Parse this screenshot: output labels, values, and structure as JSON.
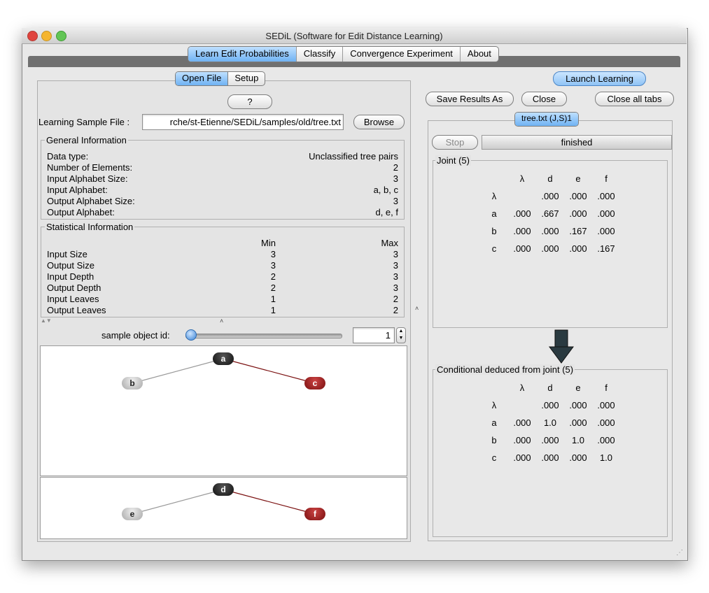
{
  "window": {
    "title": "SEDiL (Software for Edit Distance Learning)"
  },
  "main_tabs": [
    "Learn Edit Probabilities",
    "Classify",
    "Convergence Experiment",
    "About"
  ],
  "left": {
    "subtabs": [
      "Open File",
      "Setup"
    ],
    "help_label": "?",
    "file_label": "Learning Sample File :",
    "file_value": "rche/st-Etienne/SEDiL/samples/old/tree.txt",
    "browse_label": "Browse",
    "general": {
      "title": "General Information",
      "rows": [
        {
          "label": "Data type:",
          "value": "Unclassified tree pairs"
        },
        {
          "label": "Number of Elements:",
          "value": "2"
        },
        {
          "label": "Input Alphabet Size:",
          "value": "3"
        },
        {
          "label": "Input Alphabet:",
          "value": "a, b, c"
        },
        {
          "label": "Output Alphabet Size:",
          "value": "3"
        },
        {
          "label": "Output Alphabet:",
          "value": "d, e, f"
        }
      ]
    },
    "statistical": {
      "title": "Statistical Information",
      "col_min": "Min",
      "col_max": "Max",
      "rows": [
        {
          "label": "Input Size",
          "min": "3",
          "max": "3"
        },
        {
          "label": "Output Size",
          "min": "3",
          "max": "3"
        },
        {
          "label": "Input Depth",
          "min": "2",
          "max": "3"
        },
        {
          "label": "Output Depth",
          "min": "2",
          "max": "3"
        },
        {
          "label": "Input Leaves",
          "min": "1",
          "max": "2"
        },
        {
          "label": "Output Leaves",
          "min": "1",
          "max": "2"
        }
      ]
    },
    "sample_label": "sample object id:",
    "sample_value": "1",
    "slider_level": 0,
    "tree_input": {
      "root": "a",
      "left": "b",
      "right": "c"
    },
    "tree_output": {
      "root": "d",
      "left": "e",
      "right": "f"
    }
  },
  "right": {
    "launch_label": "Launch Learning",
    "save_label": "Save Results As",
    "close_label": "Close",
    "close_all_label": "Close all tabs",
    "result_tab": "tree.txt (J,S)1",
    "stop_label": "Stop",
    "status": "finished",
    "joint": {
      "title": "Joint (5)",
      "cols": [
        "λ",
        "d",
        "e",
        "f"
      ],
      "rows": [
        {
          "h": "λ",
          "c": [
            "",
            ".000",
            ".000",
            ".000"
          ]
        },
        {
          "h": "a",
          "c": [
            ".000",
            ".667",
            ".000",
            ".000"
          ]
        },
        {
          "h": "b",
          "c": [
            ".000",
            ".000",
            ".167",
            ".000"
          ]
        },
        {
          "h": "c",
          "c": [
            ".000",
            ".000",
            ".000",
            ".167"
          ]
        }
      ]
    },
    "conditional": {
      "title": "Conditional deduced from joint (5)",
      "cols": [
        "λ",
        "d",
        "e",
        "f"
      ],
      "rows": [
        {
          "h": "λ",
          "c": [
            "",
            ".000",
            ".000",
            ".000"
          ]
        },
        {
          "h": "a",
          "c": [
            ".000",
            "1.0",
            ".000",
            ".000"
          ]
        },
        {
          "h": "b",
          "c": [
            ".000",
            ".000",
            "1.0",
            ".000"
          ]
        },
        {
          "h": "c",
          "c": [
            ".000",
            ".000",
            ".000",
            "1.0"
          ]
        }
      ]
    }
  },
  "colors": {
    "tab_selected": "#6fb2f3",
    "node_root": "#111111",
    "node_left": "#bdbdbd",
    "node_right": "#8b1515",
    "edge_right": "#7a0f0f"
  }
}
